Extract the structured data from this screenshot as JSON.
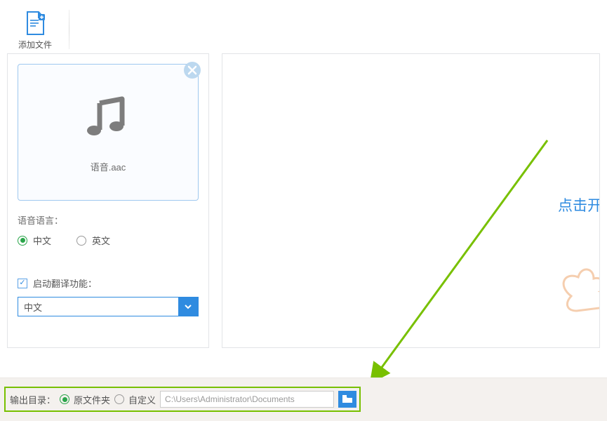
{
  "toolbar": {
    "add_file_label": "添加文件"
  },
  "file_card": {
    "filename": "语音.aac"
  },
  "language": {
    "section_label": "语音语言：",
    "option_chinese": "中文",
    "option_english": "英文"
  },
  "translate": {
    "enable_label": "启动翻译功能：",
    "selected": "中文"
  },
  "right_panel": {
    "hint": "点击开"
  },
  "output": {
    "label": "输出目录：",
    "option_original": "原文件夹",
    "option_custom": "自定义",
    "path": "C:\\Users\\Administrator\\Documents"
  }
}
